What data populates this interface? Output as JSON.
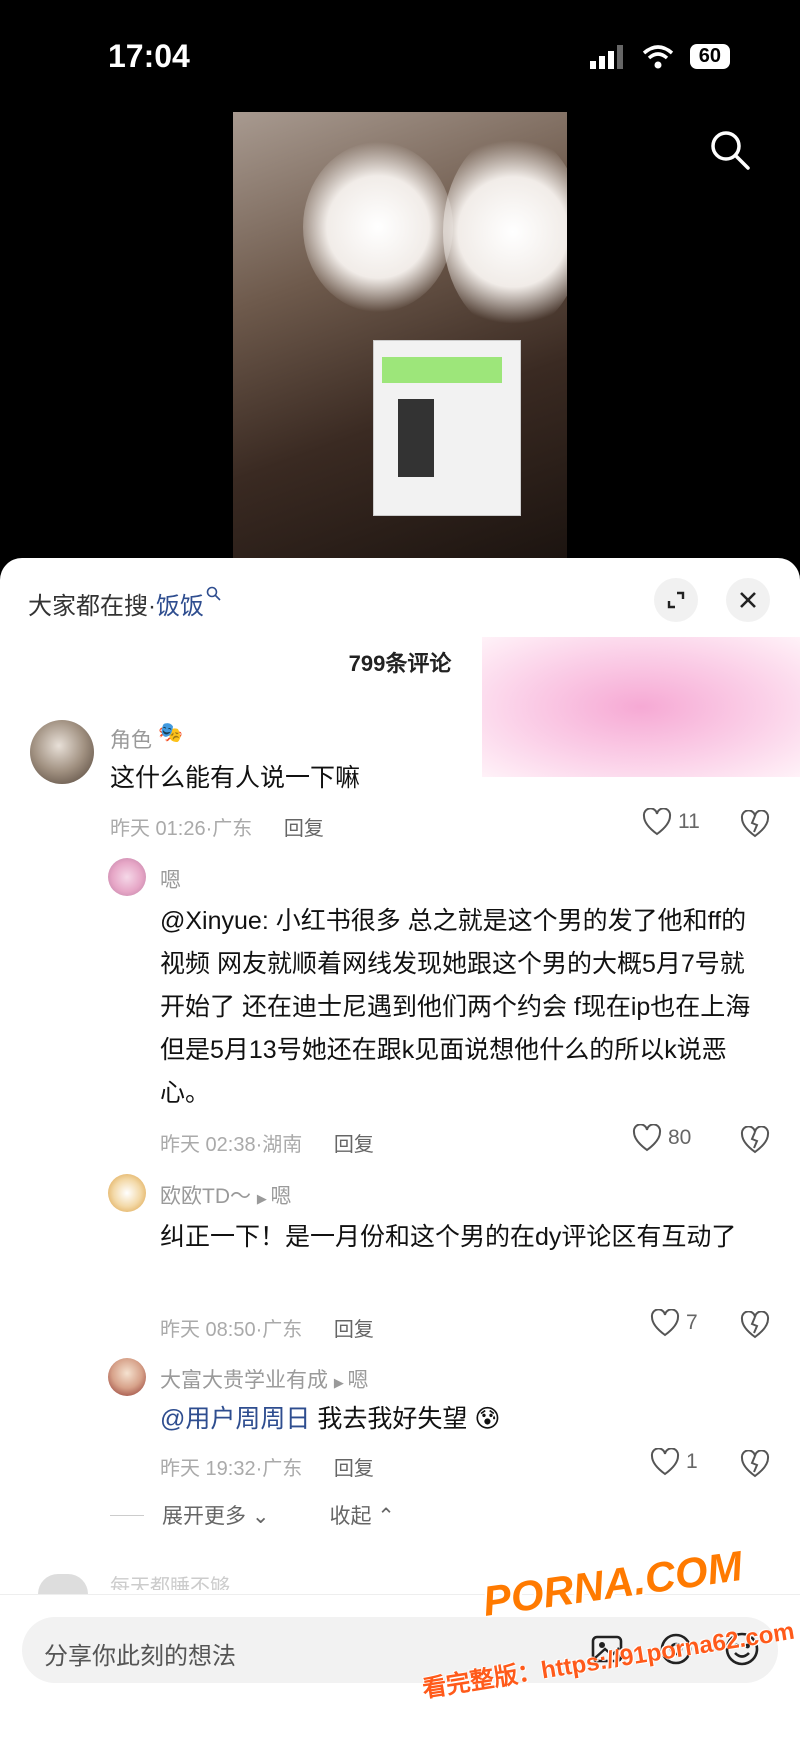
{
  "status": {
    "time": "17:04",
    "battery": "60"
  },
  "header": {
    "hot_search_prefix": "大家都在搜·",
    "hot_search_keyword": "饭饭",
    "comment_count": "799条评论"
  },
  "comments": [
    {
      "username": "角色",
      "text": "这什么能有人说一下嘛",
      "time": "昨天 01:26",
      "location": "广东",
      "reply": "回复",
      "likes": "11"
    },
    {
      "username": "嗯",
      "mention": "@Xinyue:",
      "text": "小红书很多 总之就是这个男的发了他和ff的视频 网友就顺着网线发现她跟这个男的大概5月7号就开始了 还在迪士尼遇到他们两个约会 f现在ip也在上海但是5月13号她还在跟k见面说想他什么的所以k说恶心。",
      "time": "昨天 02:38",
      "location": "湖南",
      "reply": "回复",
      "likes": "80"
    },
    {
      "username": "欧欧TD～",
      "reply_to": "嗯",
      "text": "纠正一下！是一月份和这个男的在dy评论区有互动了",
      "time": "昨天 08:50",
      "location": "广东",
      "reply": "回复",
      "likes": "7"
    },
    {
      "username": "大富大贵学业有成",
      "reply_to": "嗯",
      "mention": "@用户周周日",
      "text": "我去我好失望",
      "time": "昨天 19:32",
      "location": "广东",
      "reply": "回复",
      "likes": "1"
    }
  ],
  "thread": {
    "expand_more": "展开更多",
    "collapse": "收起"
  },
  "next_comment_preview": "每天都睡不够",
  "input": {
    "placeholder": "分享你此刻的想法"
  },
  "watermark": {
    "brand": "PORNA.COM",
    "url": "看完整版：https://91porna62.com"
  },
  "colors": {
    "mention": "#2e4d8f",
    "sheet": "#ffffff",
    "pink_ad": "#f6a9d4"
  }
}
